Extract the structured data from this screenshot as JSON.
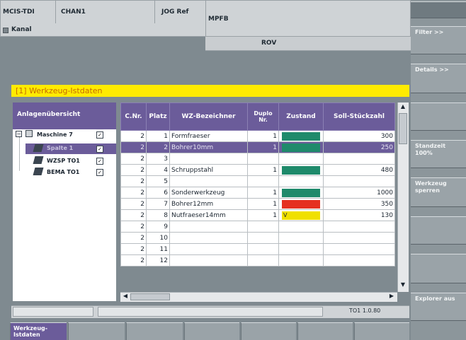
{
  "header": {
    "mode": "MCIS-TDI",
    "channel": "CHAN1",
    "jog": "JOG Ref",
    "program": "MPFB",
    "kanal": "Kanal",
    "rov": "ROV"
  },
  "softkeys": {
    "filter": "Filter >>",
    "details": "Details >>",
    "standzeit": "Standzeit 100%",
    "werkzeug_sperren": "Werkzeug sperren",
    "explorer": "Explorer aus"
  },
  "title": "[1] Werkzeug-Istdaten",
  "tree": {
    "header": "Anlagenübersicht",
    "items": [
      {
        "label": "Maschine 7",
        "checked": true
      },
      {
        "label": "Spalte 1",
        "checked": true
      },
      {
        "label": "WZSP TO1",
        "checked": true
      },
      {
        "label": "BEMA TO1",
        "checked": true
      }
    ]
  },
  "table": {
    "columns": [
      "C.Nr.",
      "Platz",
      "WZ-Bezeichner",
      "Duplo Nr.",
      "Zustand",
      "Soll-Stückzahl"
    ],
    "rows": [
      {
        "c": "2",
        "platz": "1",
        "name": "Formfraeser",
        "duplo": "1",
        "state": "green",
        "soll": "300"
      },
      {
        "c": "2",
        "platz": "2",
        "name": "Bohrer10mm",
        "duplo": "1",
        "state": "green",
        "soll": "250",
        "selected": true
      },
      {
        "c": "2",
        "platz": "3",
        "name": "",
        "duplo": "",
        "state": "",
        "soll": ""
      },
      {
        "c": "2",
        "platz": "4",
        "name": "Schruppstahl",
        "duplo": "1",
        "state": "green",
        "soll": "480"
      },
      {
        "c": "2",
        "platz": "5",
        "name": "",
        "duplo": "",
        "state": "",
        "soll": ""
      },
      {
        "c": "2",
        "platz": "6",
        "name": "Sonderwerkzeug",
        "duplo": "1",
        "state": "green",
        "soll": "1000"
      },
      {
        "c": "2",
        "platz": "7",
        "name": "Bohrer12mm",
        "duplo": "1",
        "state": "red",
        "soll": "350"
      },
      {
        "c": "2",
        "platz": "8",
        "name": "Nutfraeser14mm",
        "duplo": "1",
        "state": "yellow",
        "state_text": "V",
        "soll": "130"
      },
      {
        "c": "2",
        "platz": "9",
        "name": "",
        "duplo": "",
        "state": "",
        "soll": ""
      },
      {
        "c": "2",
        "platz": "10",
        "name": "",
        "duplo": "",
        "state": "",
        "soll": ""
      },
      {
        "c": "2",
        "platz": "11",
        "name": "",
        "duplo": "",
        "state": "",
        "soll": ""
      },
      {
        "c": "2",
        "platz": "12",
        "name": "",
        "duplo": "",
        "state": "",
        "soll": ""
      }
    ]
  },
  "status": {
    "right": "TO1 1.0.80"
  },
  "bottom_tab": {
    "label": "Werkzeug-Istdaten"
  },
  "colors": {
    "green": "#1f8a6b",
    "red": "#e53020",
    "yellow": "#f0e000",
    "header": "#6b5c9a"
  }
}
